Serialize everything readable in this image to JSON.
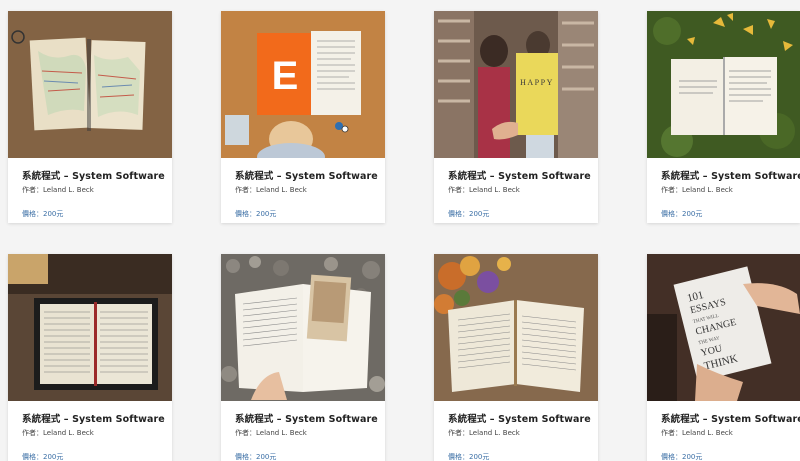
{
  "products": [
    {
      "title": "系統程式 – System Software",
      "author": "作者：Leland L. Beck",
      "price": "價格：200元",
      "image": "map-book"
    },
    {
      "title": "系統程式 – System Software",
      "author": "作者：Leland L. Beck",
      "price": "價格：200元",
      "image": "orange-e-book",
      "image_text": "E"
    },
    {
      "title": "系統程式 – System Software",
      "author": "作者：Leland L. Beck",
      "price": "價格：200元",
      "image": "happy-book-library",
      "image_text": "HAPPY"
    },
    {
      "title": "系統程式 – System Software",
      "author": "作者：Leland L. Beck",
      "price": "價格：200元",
      "image": "book-on-moss"
    },
    {
      "title": "系統程式 – System Software",
      "author": "作者：Leland L. Beck",
      "price": "價格：200元",
      "image": "bible-on-table"
    },
    {
      "title": "系統程式 – System Software",
      "author": "作者：Leland L. Beck",
      "price": "價格：200元",
      "image": "book-on-pebbles"
    },
    {
      "title": "系統程式 – System Software",
      "author": "作者：Leland L. Beck",
      "price": "價格：200元",
      "image": "bible-with-flowers"
    },
    {
      "title": "系統程式 – System Software",
      "author": "作者：Leland L. Beck",
      "price": "價格：200元",
      "image": "essays-book",
      "image_text": [
        "101",
        "ESSAYS",
        "THAT WILL",
        "CHANGE",
        "THE WAY",
        "YOU",
        "THINK"
      ]
    }
  ],
  "colors": {
    "price": "#3a6ea5",
    "title": "#222222",
    "card_bg": "#ffffff",
    "page_bg": "#f4f4f4"
  }
}
